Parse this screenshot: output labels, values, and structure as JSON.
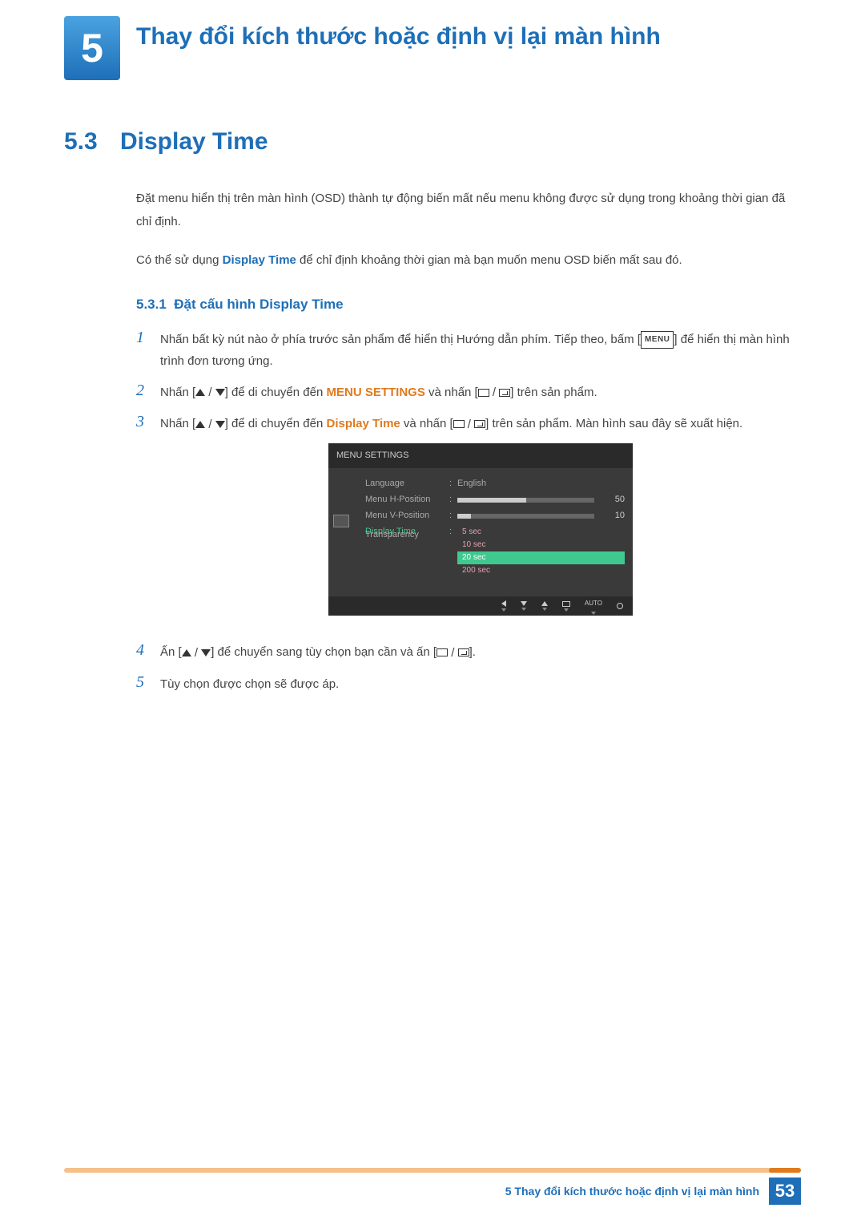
{
  "chapter": {
    "number": "5",
    "title": "Thay đổi kích thước hoặc định vị lại màn hình"
  },
  "section": {
    "number": "5.3",
    "title": "Display Time",
    "para1": "Đặt menu hiển thị trên màn hình (OSD) thành tự động biến mất nếu menu không được sử dụng trong khoảng thời gian đã chỉ định.",
    "para2_a": "Có thể sử dụng ",
    "para2_b": "Display Time",
    "para2_c": " để chỉ định khoảng thời gian mà bạn muốn menu OSD biến mất sau đó."
  },
  "subsection": {
    "number": "5.3.1",
    "title": "Đặt cấu hình Display Time"
  },
  "steps": {
    "s1_a": "Nhấn bất kỳ nút nào ở phía trước sản phẩm để hiển thị Hướng dẫn phím. Tiếp theo, bấm [",
    "s1_menu": "MENU",
    "s1_b": "] để hiển thị màn hình trình đơn tương ứng.",
    "s2_a": "Nhấn [",
    "s2_b": "] để di chuyển đến ",
    "s2_c": "MENU SETTINGS",
    "s2_d": " và nhấn [",
    "s2_e": "] trên sản phẩm.",
    "s3_a": "Nhấn [",
    "s3_b": "] để di chuyển đến ",
    "s3_c": "Display Time",
    "s3_d": " và nhấn [",
    "s3_e": "] trên sản phẩm. Màn hình sau đây sẽ xuất hiện.",
    "s4_a": "Ấn [",
    "s4_b": "] để chuyển sang tùy chọn bạn cần và ấn [",
    "s4_c": "].",
    "s5": "Tùy chọn được chọn sẽ được áp."
  },
  "osd": {
    "title": "MENU SETTINGS",
    "rows": {
      "language": {
        "label": "Language",
        "value": "English"
      },
      "hpos": {
        "label": "Menu H-Position",
        "value": "50",
        "fill": 50
      },
      "vpos": {
        "label": "Menu V-Position",
        "value": "10",
        "fill": 10
      },
      "displaytime": {
        "label": "Display Time"
      },
      "transparency": {
        "label": "Transparency"
      }
    },
    "options": [
      "5 sec",
      "10 sec",
      "20 sec",
      "200 sec"
    ],
    "selected_index": 2,
    "auto_label": "AUTO"
  },
  "footer": {
    "text": "5 Thay đổi kích thước hoặc định vị lại màn hình",
    "page": "53"
  }
}
